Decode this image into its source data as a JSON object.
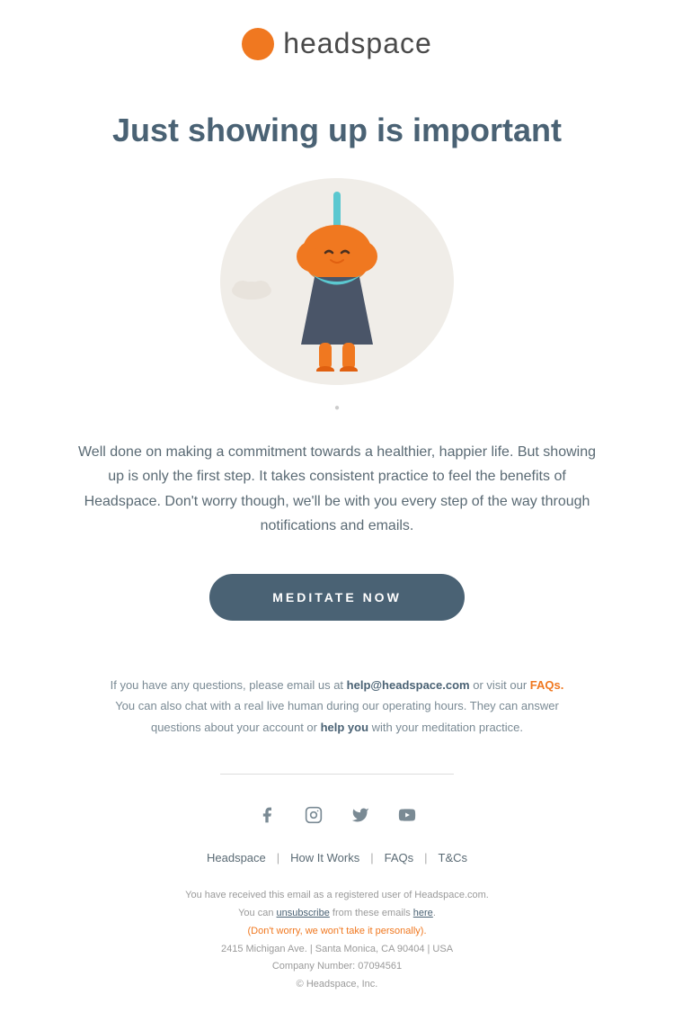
{
  "header": {
    "logo_text": "headspace",
    "logo_dot_color": "#f07820"
  },
  "hero": {
    "title": "Just showing up is important"
  },
  "body": {
    "paragraph": "Well done on making a commitment towards a healthier, happier life. But showing up is only the first step. It takes consistent practice to feel the benefits of Headspace. Don't worry though, we'll be with you every step of the way through notifications and emails."
  },
  "cta": {
    "label": "MEDITATE NOW"
  },
  "footer_info": {
    "line1_pre": "If you have any questions, please email us at ",
    "email": "help@headspace.com",
    "line1_post": " or visit our ",
    "faqs": "FAQs.",
    "line2_pre": "You can also chat with a real live human during our operating hours. They can answer questions about your account or ",
    "help_link": "help you",
    "line2_post": " with your meditation practice."
  },
  "social": {
    "icons": [
      "facebook",
      "instagram",
      "twitter",
      "youtube"
    ]
  },
  "footer_nav": {
    "items": [
      "Headspace",
      "How It Works",
      "FAQs",
      "T&Cs"
    ],
    "separators": [
      "|",
      "|",
      "|"
    ]
  },
  "footer_legal": {
    "line1": "You have received this email as a registered user of Headspace.com.",
    "line2_pre": "You can ",
    "unsubscribe": "unsubscribe",
    "line2_mid": " from these emails ",
    "here": "here",
    "line2_post": ".",
    "line3": "(Don't worry, we won't take it personally).",
    "line4": "2415 Michigan Ave. | Santa Monica, CA 90404 | USA",
    "line5": "Company Number: 07094561",
    "line6": "© Headspace, Inc."
  },
  "colors": {
    "orange": "#f07820",
    "dark_teal": "#4a6274",
    "body_text": "#5a6a74",
    "light_bg": "#f0ede8"
  }
}
